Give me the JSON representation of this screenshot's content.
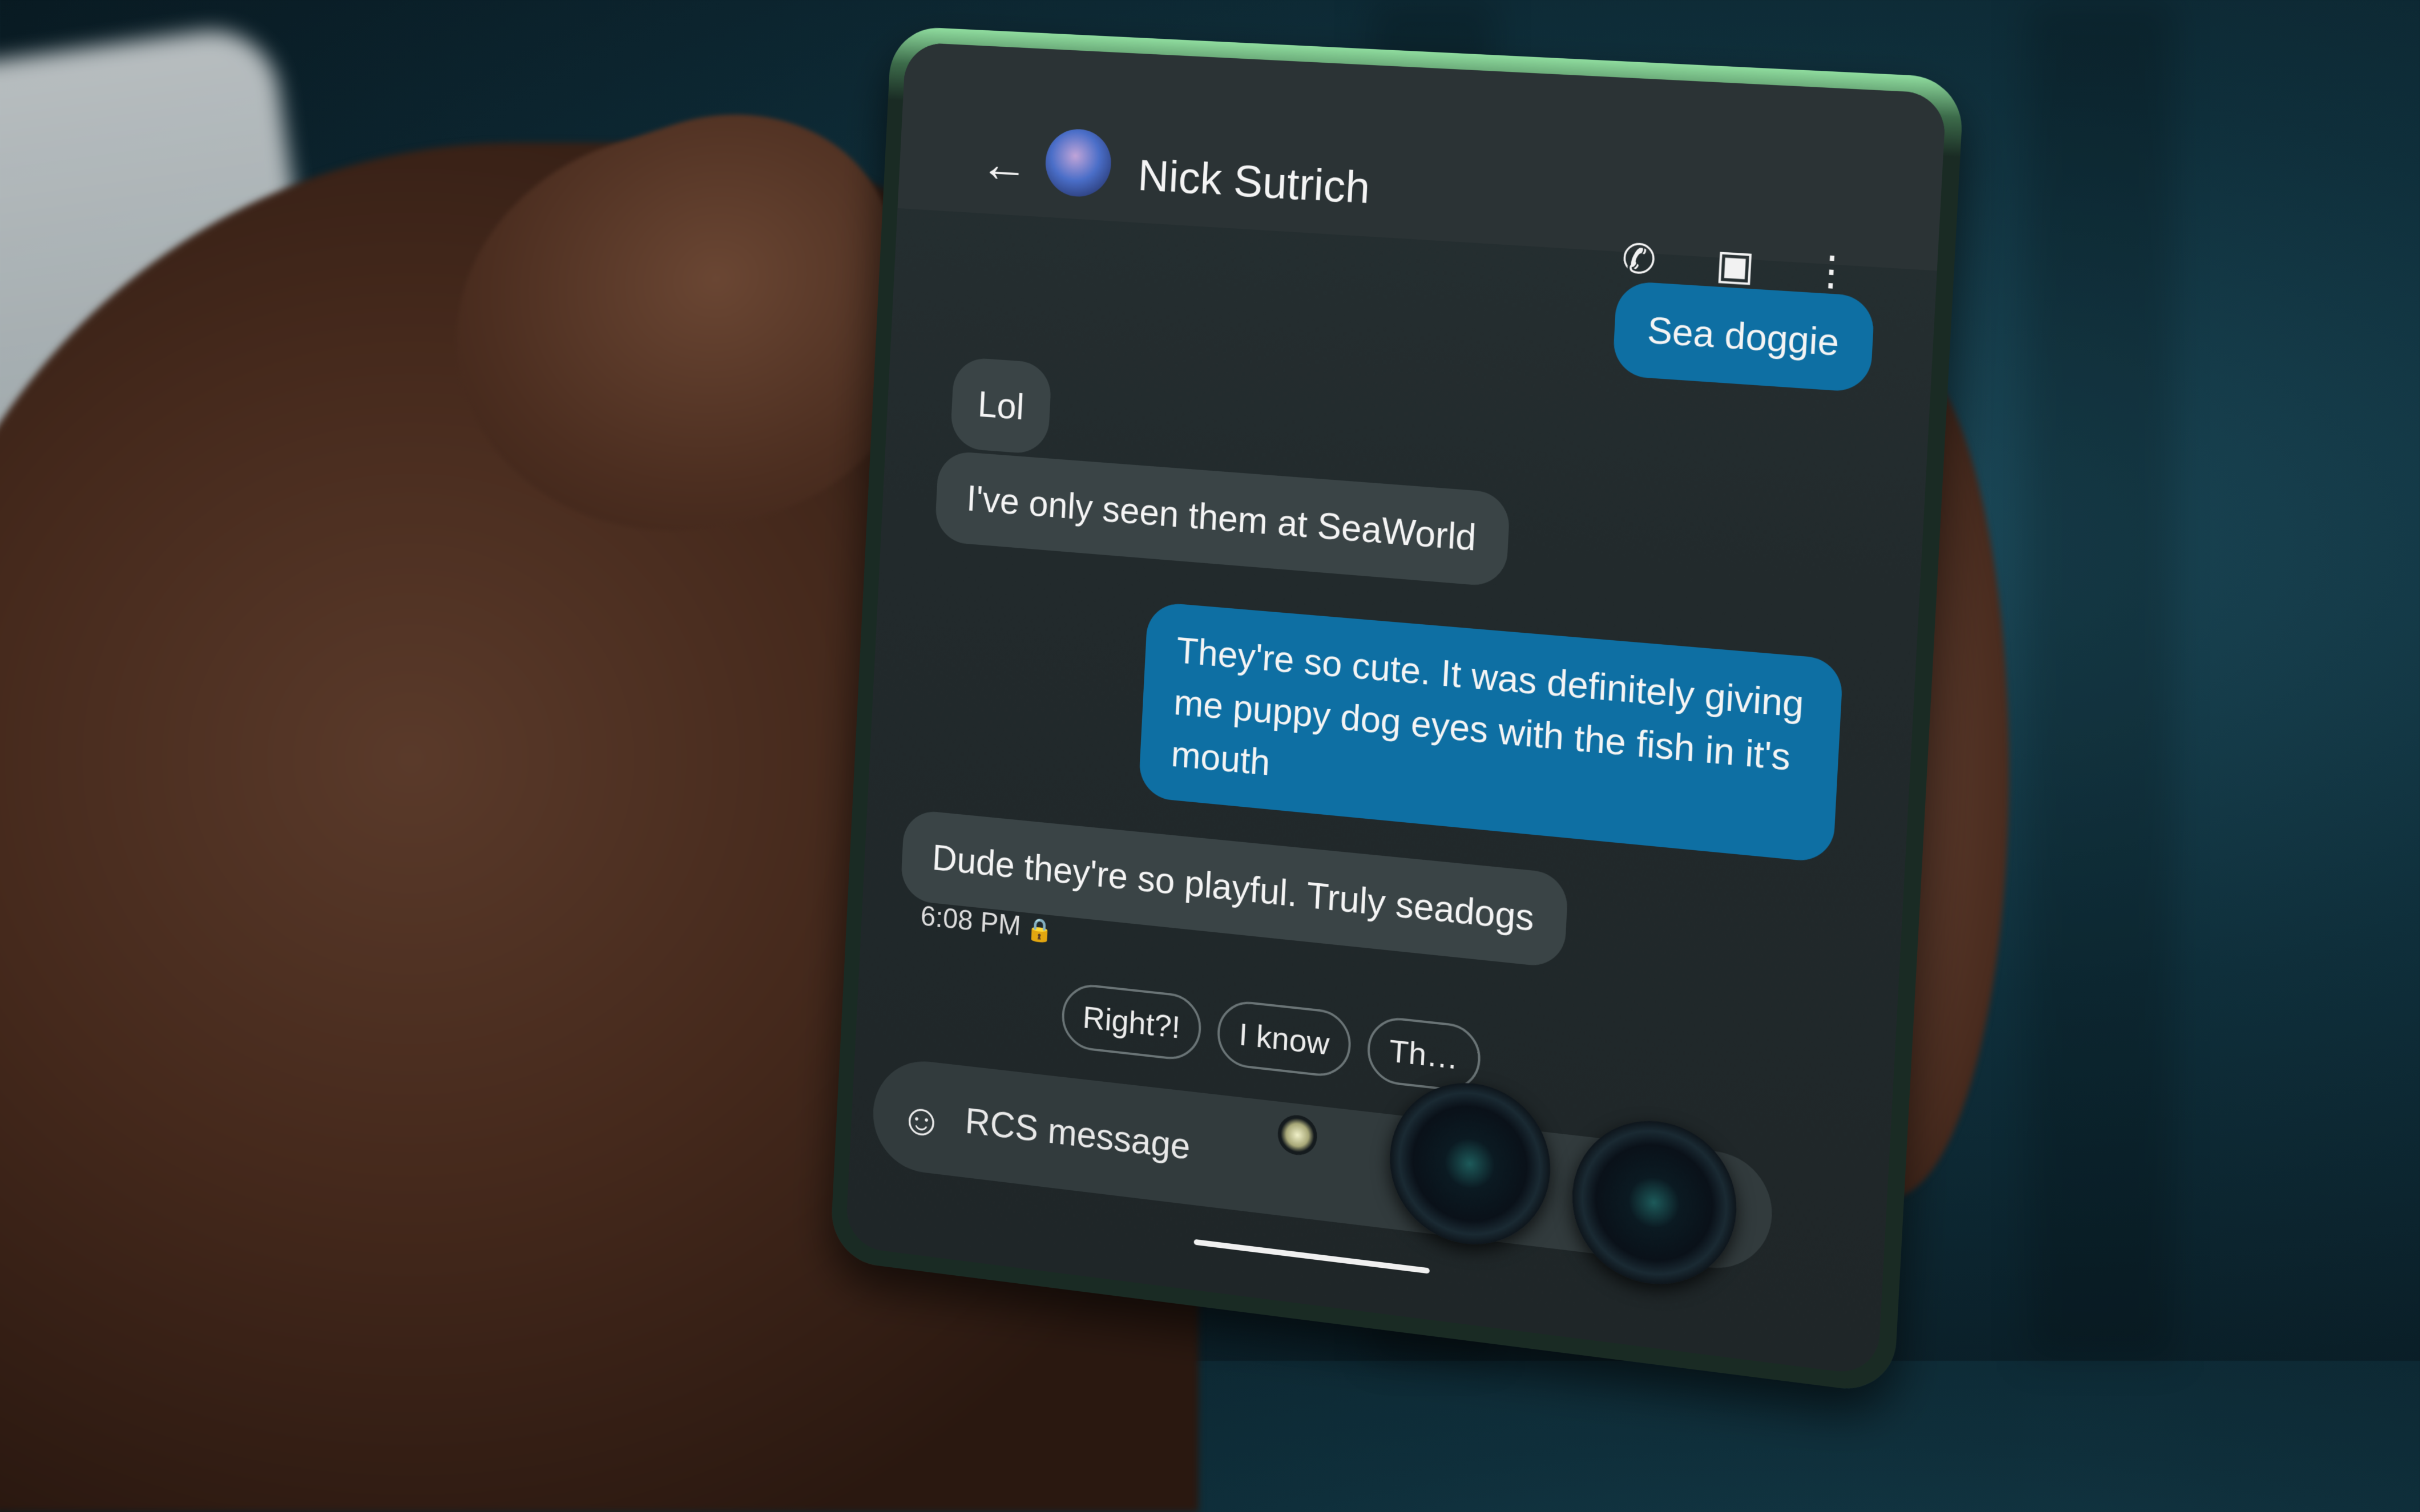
{
  "app": {
    "header": {
      "back_icon": "arrow-left",
      "contact_name": "Nick Sutrich",
      "call_icon": "phone",
      "video_icon": "video-camera",
      "more_icon": "more-vertical"
    },
    "messages": [
      {
        "direction": "outgoing",
        "text": "Sea doggie"
      },
      {
        "direction": "incoming",
        "text": "Lol"
      },
      {
        "direction": "incoming",
        "text": "I've only seen them at SeaWorld"
      },
      {
        "direction": "outgoing",
        "text": "They're so cute. It was definitely giving me puppy dog eyes with the fish in it's mouth"
      },
      {
        "direction": "incoming",
        "text": "Dude they're so playful. Truly seadogs"
      }
    ],
    "last_timestamp": "6:08 PM",
    "timestamp_icon": "lock",
    "smart_replies": [
      "Right?!",
      "I know",
      "Th…"
    ],
    "composer": {
      "emoji_icon": "smiley",
      "placeholder": "RCS message"
    },
    "colors": {
      "outgoing_bubble": "#0e6fa3",
      "incoming_bubble": "#3a4446",
      "background": "#222a2c"
    }
  }
}
